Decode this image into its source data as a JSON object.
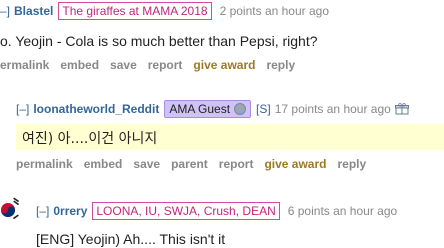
{
  "comment1": {
    "author": "Blastel",
    "flair": "The giraffes at MAMA 2018",
    "meta": "2 points an hour ago",
    "body": "o. Yeojin - Cola is so much better than Pepsi, right?",
    "buttons": [
      "ermalink",
      "embed",
      "save",
      "report",
      "give award",
      "reply"
    ]
  },
  "comment2": {
    "collapse": "[–]",
    "author": "loonatheworld_Reddit",
    "flair": "AMA Guest",
    "tag": "[S]",
    "meta": "17 points an hour ago",
    "body": "여진) 아....이건 아니지",
    "buttons": [
      "permalink",
      "embed",
      "save",
      "parent",
      "report",
      "give award",
      "reply"
    ]
  },
  "comment3": {
    "collapse": "[–]",
    "author": "0rrery",
    "flair": "LOONA, IU, SWJA, Crush, DEAN",
    "meta": "6 points an hour ago",
    "body": "[ENG] Yeojin) Ah.... This isn't it"
  },
  "colors": {
    "link": "#336699",
    "award": "#9b7a21",
    "highlight": "#ffffd2",
    "flair_pink_border": "#d54b9b",
    "flair_ama_bg": "#cfc2f5"
  }
}
